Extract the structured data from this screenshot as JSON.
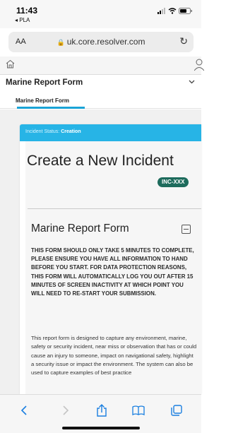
{
  "status_bar": {
    "time": "11:43",
    "back_app": "◂ PLA"
  },
  "browser": {
    "text_size_label": "AA",
    "url": "uk.core.resolver.com"
  },
  "app": {
    "form_name": "Marine Report Form",
    "active_tab": "Marine Report Form"
  },
  "incident": {
    "status_label": "Incident Status:",
    "status_value": "Creation",
    "title": "Create a New Incident",
    "id_badge": "INC-XXX"
  },
  "section": {
    "title": "Marine Report Form",
    "warning": "THIS FORM SHOULD ONLY TAKE 5 MINUTES TO COMPLETE, PLEASE ENSURE YOU HAVE ALL INFORMATION TO HAND BEFORE YOU START. FOR DATA PROTECTION REASONS, THIS FORM WILL AUTOMATICALLY LOG YOU OUT AFTER 15 MINUTES OF SCREEN INACTIVITY AT WHICH POINT YOU WILL NEED TO RE-START YOUR SUBMISSION.",
    "description": "This report form is designed to capture any environment, marine, safety or security incident, near miss or observation that has or could cause an injury to someone, impact on navigational safety, highlight a security issue or impact the environment. The system can also be used to capture examples of best practice"
  },
  "colors": {
    "accent": "#27b4e6",
    "badge": "#1d6b5c",
    "tab_underline": "#1aa3d6"
  },
  "icons": [
    "signal-icon",
    "wifi-icon",
    "battery-icon",
    "lock-icon",
    "reload-icon",
    "home-icon",
    "user-icon",
    "chevron-down-icon",
    "collapse-icon",
    "back-icon",
    "forward-icon",
    "share-icon",
    "bookmarks-icon",
    "tabs-icon"
  ]
}
